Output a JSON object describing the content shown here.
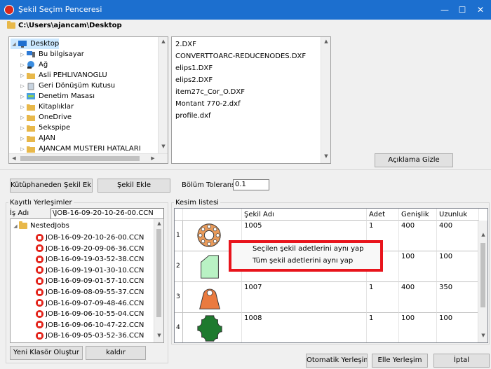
{
  "window": {
    "title": "Şekil Seçim Penceresi",
    "minimize": "—",
    "maximize": "☐",
    "close": "✕"
  },
  "path": "C:\\Users\\ajancam\\Desktop",
  "tree": [
    {
      "label": "Desktop",
      "expander": "◢",
      "icon": "desktop-icon"
    },
    {
      "label": "Bu bilgisayar",
      "expander": "▷",
      "icon": "computer-icon"
    },
    {
      "label": "Ağ",
      "expander": "▷",
      "icon": "network-icon"
    },
    {
      "label": "Asli PEHLIVANOGLU",
      "expander": "▷",
      "icon": "folder-icon"
    },
    {
      "label": "Geri Dönüşüm Kutusu",
      "expander": "▷",
      "icon": "recycle-bin-icon"
    },
    {
      "label": "Denetim Masası",
      "expander": "▷",
      "icon": "control-panel-icon"
    },
    {
      "label": "Kitaplıklar",
      "expander": "▷",
      "icon": "folder-icon"
    },
    {
      "label": "OneDrive",
      "expander": "▷",
      "icon": "folder-icon"
    },
    {
      "label": "5ekspipe",
      "expander": "▷",
      "icon": "folder-icon"
    },
    {
      "label": "AJAN",
      "expander": "▷",
      "icon": "folder-icon"
    },
    {
      "label": "AJANCAM MUSTERI HATALARI",
      "expander": "▷",
      "icon": "folder-icon"
    }
  ],
  "files": [
    "2.DXF",
    "CONVERTTOARC-REDUCENODES.DXF",
    "elips1.DXF",
    "elips2.DXF",
    "item27c_Cor_O.DXF",
    "Montant 770-2.dxf",
    "profile.dxf"
  ],
  "buttons": {
    "hide_description": "Açıklama Gizle",
    "add_from_library": "Kütüphaneden Şekil Ekle",
    "add_shape": "Şekil Ekle",
    "new_folder": "Yeni Klasör Oluştur",
    "remove": "kaldır",
    "auto_nest": "Otomatik Yerleşim",
    "manual_nest": "Elle Yerleşim",
    "cancel": "İptal"
  },
  "tolerance": {
    "label": "Bölüm Tolerans",
    "value": "0.1"
  },
  "saved": {
    "group_title": "Kayıtlı Yerleşimler",
    "job_name_label": "İş Adı",
    "job_name_value": "\\JOB-16-09-20-10-26-00.CCN",
    "root_folder": "NestedJobs",
    "jobs": [
      "JOB-16-09-20-10-26-00.CCN",
      "JOB-16-09-20-09-06-36.CCN",
      "JOB-16-09-19-03-52-38.CCN",
      "JOB-16-09-19-01-30-10.CCN",
      "JOB-16-09-09-01-57-10.CCN",
      "JOB-16-09-08-09-55-37.CCN",
      "JOB-16-09-07-09-48-46.CCN",
      "JOB-16-09-06-10-55-04.CCN",
      "JOB-16-09-06-10-47-22.CCN",
      "JOB-16-09-05-03-52-36.CCN"
    ]
  },
  "cut_list": {
    "group_title": "Kesim listesi",
    "columns": [
      "Şekil Adı",
      "Adet",
      "Genişlik",
      "Uzunluk"
    ],
    "rows": [
      {
        "index": "1",
        "name": "1005",
        "qty": "1",
        "width": "400",
        "length": "400",
        "shape": "flange",
        "color": "#e89a5a"
      },
      {
        "index": "2",
        "name": "",
        "qty": "",
        "width": "100",
        "length": "100",
        "shape": "pentagon",
        "color": "#b9f2c4"
      },
      {
        "index": "3",
        "name": "1007",
        "qty": "1",
        "width": "400",
        "length": "350",
        "shape": "arch",
        "color": "#ea7a3f"
      },
      {
        "index": "4",
        "name": "1008",
        "qty": "1",
        "width": "100",
        "length": "100",
        "shape": "cross",
        "color": "#1e7a2e"
      }
    ]
  },
  "context_menu": [
    "Seçilen şekil adetlerini aynı yap",
    "Tüm şekil adetlerini aynı yap"
  ],
  "colors": {
    "title_bar": "#1c6fcf",
    "highlight": "#e8141c",
    "window_bg": "#f0f0f0"
  }
}
